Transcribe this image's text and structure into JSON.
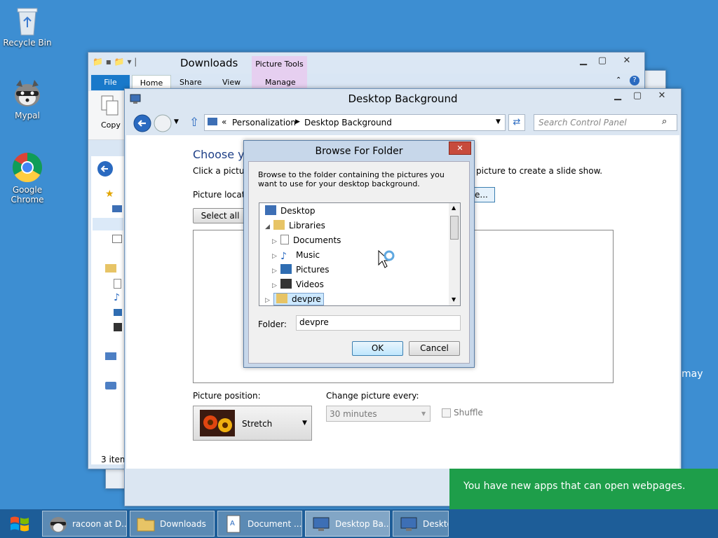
{
  "desktop": {
    "icons": [
      {
        "label": "Recycle Bin"
      },
      {
        "label": "Mypal"
      },
      {
        "label": "Google Chrome"
      }
    ],
    "partial_text": "may"
  },
  "explorer": {
    "title": "Downloads",
    "contextual_tab_group": "Picture Tools",
    "tabs": [
      "File",
      "Home",
      "Share",
      "View",
      "Manage"
    ],
    "ribbon_copy_label": "Copy",
    "status": "3 item"
  },
  "desktop_background": {
    "title": "Desktop Background",
    "breadcrumb": [
      "Personalization",
      "Desktop Background"
    ],
    "breadcrumb_prefix": "«",
    "search_placeholder": "Search Control Panel",
    "heading": "Choose yo",
    "instruction_left": "Click a picture",
    "instruction_right": "picture to create a slide show.",
    "picture_location_label": "Picture locatio",
    "browse_partial": "e...",
    "select_all_label": "Select all",
    "picture_position_label": "Picture position:",
    "picture_position_value": "Stretch",
    "change_every_label": "Change picture every:",
    "change_every_value": "30 minutes",
    "shuffle_label": "Shuffle"
  },
  "dialog": {
    "title": "Browse For Folder",
    "description": "Browse to the folder containing the pictures you want to use for your desktop background.",
    "tree": [
      {
        "label": "Desktop",
        "icon": "desktop-icon"
      },
      {
        "label": "Libraries",
        "icon": "libraries-icon"
      },
      {
        "label": "Documents",
        "icon": "documents-icon"
      },
      {
        "label": "Music",
        "icon": "music-icon"
      },
      {
        "label": "Pictures",
        "icon": "pictures-icon"
      },
      {
        "label": "Videos",
        "icon": "videos-icon"
      },
      {
        "label": "devpre",
        "icon": "user-folder-icon"
      }
    ],
    "folder_label": "Folder:",
    "folder_value": "devpre",
    "ok_label": "OK",
    "cancel_label": "Cancel"
  },
  "toast": {
    "message": "You have new apps that can open webpages.",
    "color": "#1e9e4a"
  },
  "taskbar": {
    "items": [
      {
        "label": "racoon at D..."
      },
      {
        "label": "Downloads"
      },
      {
        "label": "Document ..."
      },
      {
        "label": "Desktop Ba..."
      },
      {
        "label": "Desktop"
      }
    ]
  },
  "colors": {
    "desktop": "#3d8ed2",
    "accent": "#1979ca",
    "selection": "#cce8ff"
  }
}
